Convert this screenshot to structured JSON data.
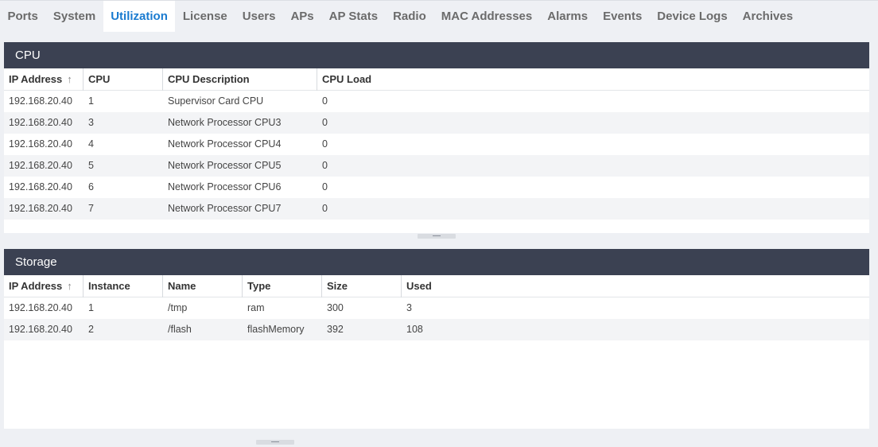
{
  "tabs": [
    {
      "label": "Ports",
      "active": false
    },
    {
      "label": "System",
      "active": false
    },
    {
      "label": "Utilization",
      "active": true
    },
    {
      "label": "License",
      "active": false
    },
    {
      "label": "Users",
      "active": false
    },
    {
      "label": "APs",
      "active": false
    },
    {
      "label": "AP Stats",
      "active": false
    },
    {
      "label": "Radio",
      "active": false
    },
    {
      "label": "MAC Addresses",
      "active": false
    },
    {
      "label": "Alarms",
      "active": false
    },
    {
      "label": "Events",
      "active": false
    },
    {
      "label": "Device Logs",
      "active": false
    },
    {
      "label": "Archives",
      "active": false
    }
  ],
  "cpu": {
    "title": "CPU",
    "columns": [
      "IP Address",
      "CPU",
      "CPU Description",
      "CPU Load"
    ],
    "sort_icon": "sort-ascending-icon",
    "rows": [
      [
        "192.168.20.40",
        "1",
        "Supervisor Card CPU",
        "0"
      ],
      [
        "192.168.20.40",
        "3",
        "Network Processor CPU3",
        "0"
      ],
      [
        "192.168.20.40",
        "4",
        "Network Processor CPU4",
        "0"
      ],
      [
        "192.168.20.40",
        "5",
        "Network Processor CPU5",
        "0"
      ],
      [
        "192.168.20.40",
        "6",
        "Network Processor CPU6",
        "0"
      ],
      [
        "192.168.20.40",
        "7",
        "Network Processor CPU7",
        "0"
      ]
    ]
  },
  "storage": {
    "title": "Storage",
    "columns": [
      "IP Address",
      "Instance",
      "Name",
      "Type",
      "Size",
      "Used"
    ],
    "sort_icon": "sort-ascending-icon",
    "rows": [
      [
        "192.168.20.40",
        "1",
        "/tmp",
        "ram",
        "300",
        "3"
      ],
      [
        "192.168.20.40",
        "2",
        "/flash",
        "flashMemory",
        "392",
        "108"
      ]
    ]
  },
  "colors": {
    "header_bg": "#3b4152",
    "active_tab_text": "#1a7bd0",
    "page_bg": "#eef0f4"
  }
}
